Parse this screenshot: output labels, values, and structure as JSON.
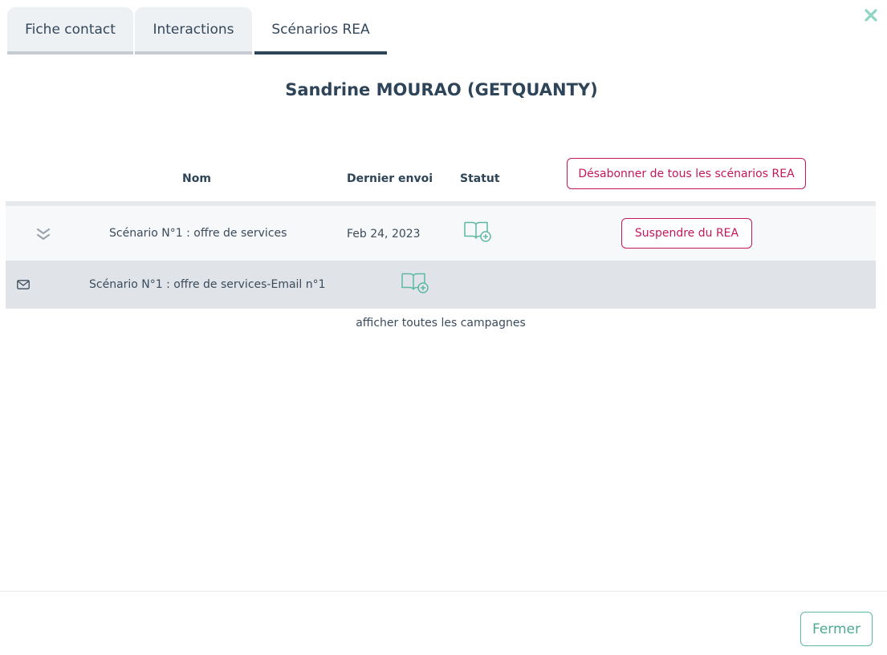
{
  "tabs": [
    {
      "label": "Fiche contact"
    },
    {
      "label": "Interactions"
    },
    {
      "label": "Scénarios REA"
    }
  ],
  "active_tab": "Scénarios REA",
  "title": "Sandrine MOURAO (GETQUANTY)",
  "table": {
    "headers": {
      "name": "Nom",
      "last_sent": "Dernier envoi",
      "status": "Statut"
    },
    "unsubscribe_all_label": "Désabonner de tous les scénarios REA",
    "rows": [
      {
        "name": "Scénario N°1 : offre de services",
        "last_sent": "Feb 24, 2023",
        "status_icon": "book-plus-icon",
        "action_label": "Suspendre du REA",
        "expand_icon": "double-chevron-down-icon"
      }
    ],
    "sub_rows": [
      {
        "type_icon": "envelope-icon",
        "name": "Scénario N°1 : offre de services-Email n°1",
        "status_icon": "book-plus-icon"
      }
    ]
  },
  "show_all_label": "afficher toutes les campagnes",
  "footer": {
    "close_label": "Fermer"
  },
  "colors": {
    "accent_pink": "#c2185b",
    "accent_teal": "#5fb8a4",
    "dark_blue": "#2e4559"
  }
}
